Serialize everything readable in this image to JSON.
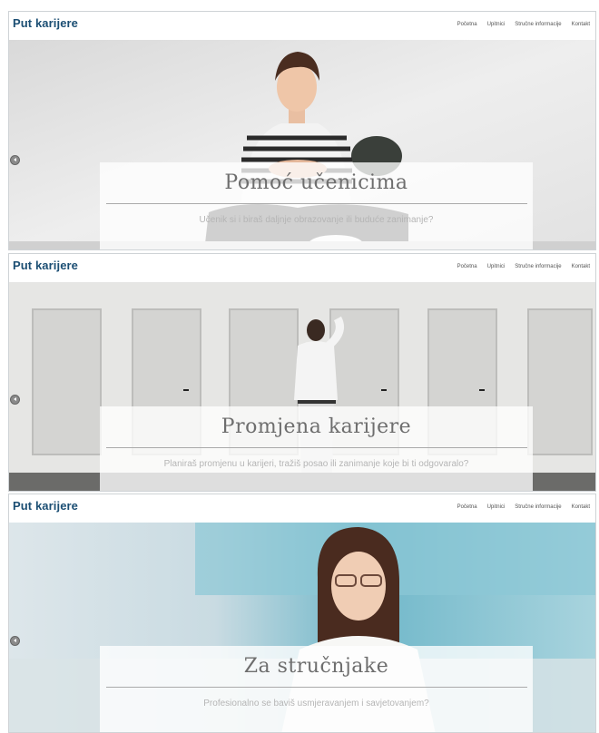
{
  "slides": [
    {
      "brand": "Put karijere",
      "nav": [
        "Početna",
        "Upitnici",
        "Stručne informacije",
        "Kontakt"
      ],
      "title": "Pomoć učenicima",
      "subtitle": "Učenik si i biraš daljnje obrazovanje ili buduće zanimanje?"
    },
    {
      "brand": "Put karijere",
      "nav": [
        "Početna",
        "Upitnici",
        "Stručne informacije",
        "Kontakt"
      ],
      "title": "Promjena karijere",
      "subtitle": "Planiraš promjenu u karijeri, tražiš posao ili zanimanje koje bi ti odgovaralo?"
    },
    {
      "brand": "Put karijere",
      "nav": [
        "Početna",
        "Upitnici",
        "Stručne informacije",
        "Kontakt"
      ],
      "title": "Za stručnjake",
      "subtitle": "Profesionalno se baviš usmjeravanjem i savjetovanjem?"
    }
  ],
  "colors": {
    "brand": "#1b4e73",
    "nav_text": "#555555",
    "caption_title": "#6e6e6e"
  },
  "icons": {
    "prev_arrow": "chevron-left-icon"
  }
}
